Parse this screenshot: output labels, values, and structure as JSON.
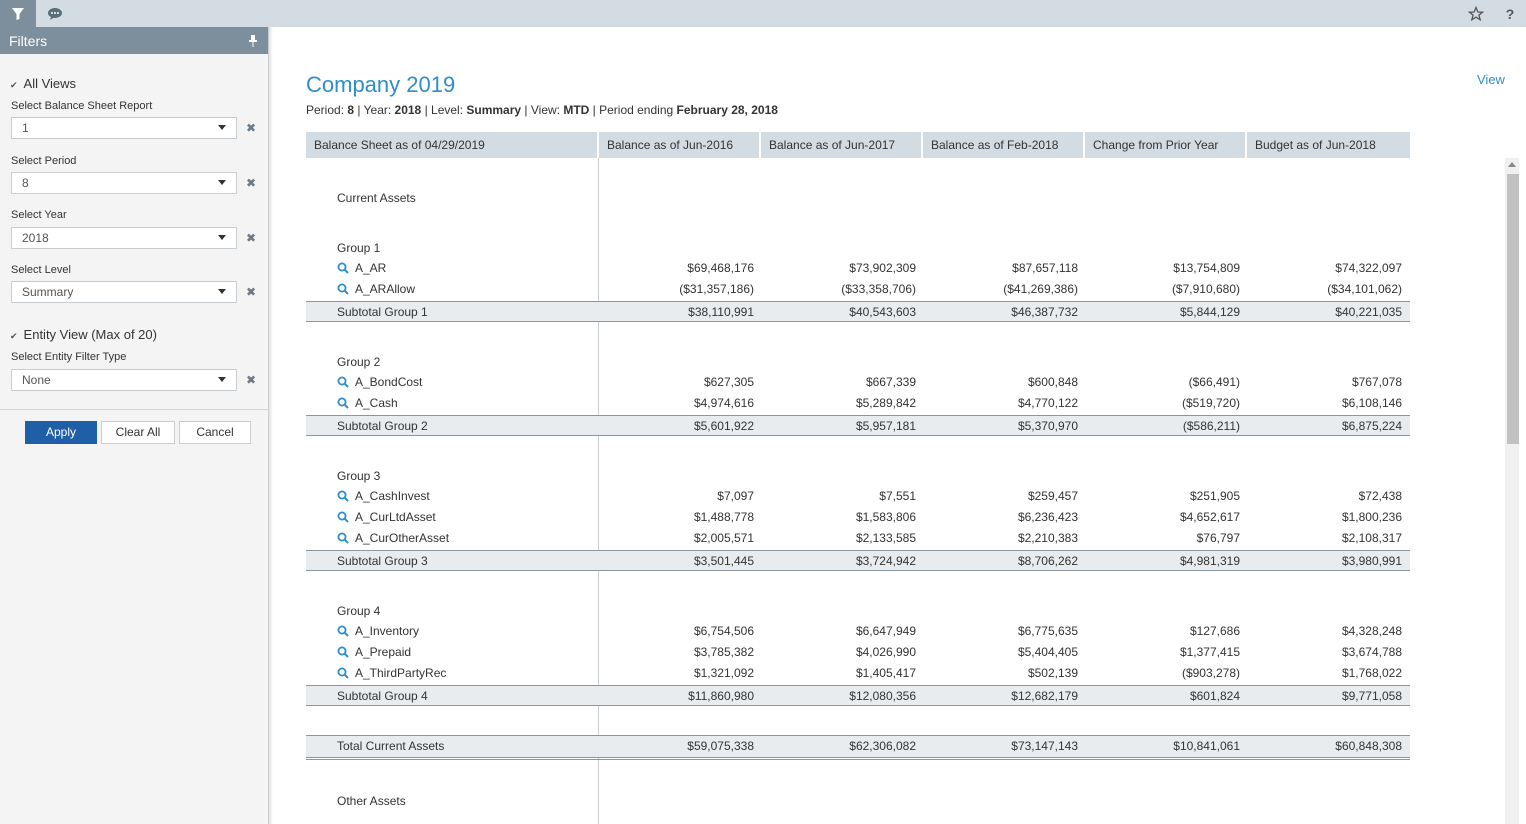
{
  "topbar": {
    "filter_icon": "filter-icon",
    "comment_icon": "comment-icon",
    "star_icon": "star-icon",
    "help_label": "?"
  },
  "filters": {
    "title": "Filters",
    "all_views": "All Views",
    "balance_sheet_label": "Select Balance Sheet Report",
    "balance_sheet_value": "1",
    "period_label": "Select Period",
    "period_value": "8",
    "year_label": "Select Year",
    "year_value": "2018",
    "level_label": "Select Level",
    "level_value": "Summary",
    "entity_view": "Entity View (Max of 20)",
    "entity_filter_label": "Select Entity Filter Type",
    "entity_filter_value": "None",
    "apply": "Apply",
    "clear_all": "Clear All",
    "cancel": "Cancel",
    "clear_glyph": "✖"
  },
  "main": {
    "title": "Company 2019",
    "view_link": "View",
    "period_prefix": "Period: ",
    "period": "8",
    "year_prefix": " | Year: ",
    "year": "2018",
    "level_prefix": " | Level: ",
    "level": "Summary",
    "view_prefix": " | View: ",
    "view": "MTD",
    "ending_prefix": " | Period ending ",
    "ending": "February 28, 2018"
  },
  "table": {
    "headers": [
      "Balance Sheet as of 04/29/2019",
      "Balance as of Jun-2016",
      "Balance as of Jun-2017",
      "Balance as of Feb-2018",
      "Change from Prior Year",
      "Budget as of Jun-2018"
    ],
    "current_assets": "Current Assets",
    "groups": [
      {
        "name": "Group 1",
        "accounts": [
          {
            "name": "A_AR",
            "values": [
              "$69,468,176",
              "$73,902,309",
              "$87,657,118",
              "$13,754,809",
              "$74,322,097"
            ]
          },
          {
            "name": "A_ARAllow",
            "values": [
              "($31,357,186)",
              "($33,358,706)",
              "($41,269,386)",
              "($7,910,680)",
              "($34,101,062)"
            ]
          }
        ],
        "subtotal_label": "Subtotal Group 1",
        "subtotal": [
          "$38,110,991",
          "$40,543,603",
          "$46,387,732",
          "$5,844,129",
          "$40,221,035"
        ]
      },
      {
        "name": "Group 2",
        "accounts": [
          {
            "name": "A_BondCost",
            "values": [
              "$627,305",
              "$667,339",
              "$600,848",
              "($66,491)",
              "$767,078"
            ]
          },
          {
            "name": "A_Cash",
            "values": [
              "$4,974,616",
              "$5,289,842",
              "$4,770,122",
              "($519,720)",
              "$6,108,146"
            ]
          }
        ],
        "subtotal_label": "Subtotal Group 2",
        "subtotal": [
          "$5,601,922",
          "$5,957,181",
          "$5,370,970",
          "($586,211)",
          "$6,875,224"
        ]
      },
      {
        "name": "Group 3",
        "accounts": [
          {
            "name": "A_CashInvest",
            "values": [
              "$7,097",
              "$7,551",
              "$259,457",
              "$251,905",
              "$72,438"
            ]
          },
          {
            "name": "A_CurLtdAsset",
            "values": [
              "$1,488,778",
              "$1,583,806",
              "$6,236,423",
              "$4,652,617",
              "$1,800,236"
            ]
          },
          {
            "name": "A_CurOtherAsset",
            "values": [
              "$2,005,571",
              "$2,133,585",
              "$2,210,383",
              "$76,797",
              "$2,108,317"
            ]
          }
        ],
        "subtotal_label": "Subtotal Group 3",
        "subtotal": [
          "$3,501,445",
          "$3,724,942",
          "$8,706,262",
          "$4,981,319",
          "$3,980,991"
        ]
      },
      {
        "name": "Group 4",
        "accounts": [
          {
            "name": "A_Inventory",
            "values": [
              "$6,754,506",
              "$6,647,949",
              "$6,775,635",
              "$127,686",
              "$4,328,248"
            ]
          },
          {
            "name": "A_Prepaid",
            "values": [
              "$3,785,382",
              "$4,026,990",
              "$5,404,405",
              "$1,377,415",
              "$3,674,788"
            ]
          },
          {
            "name": "A_ThirdPartyRec",
            "values": [
              "$1,321,092",
              "$1,405,417",
              "$502,139",
              "($903,278)",
              "$1,768,022"
            ]
          }
        ],
        "subtotal_label": "Subtotal Group 4",
        "subtotal": [
          "$11,860,980",
          "$12,080,356",
          "$12,682,179",
          "$601,824",
          "$9,771,058"
        ]
      }
    ],
    "total_label": "Total Current Assets",
    "total": [
      "$59,075,338",
      "$62,306,082",
      "$73,147,143",
      "$10,841,061",
      "$60,848,308"
    ],
    "other_assets": "Other Assets"
  }
}
